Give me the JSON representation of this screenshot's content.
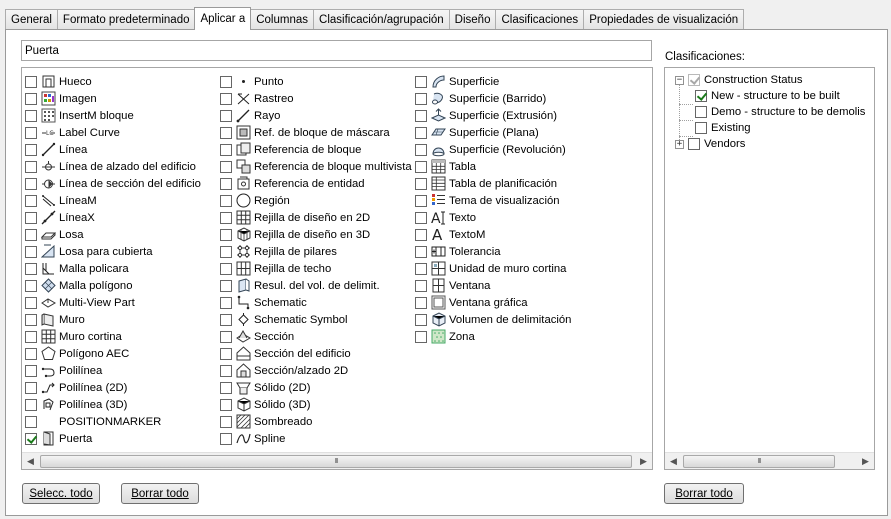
{
  "tabs": [
    {
      "label": "General",
      "active": false
    },
    {
      "label": "Formato predeterminado",
      "active": false
    },
    {
      "label": "Aplicar a",
      "active": true
    },
    {
      "label": "Columnas",
      "active": false
    },
    {
      "label": "Clasificación/agrupación",
      "active": false
    },
    {
      "label": "Diseño",
      "active": false
    },
    {
      "label": "Clasificaciones",
      "active": false
    },
    {
      "label": "Propiedades de visualización",
      "active": false
    }
  ],
  "filter_input": {
    "value": "Puerta"
  },
  "objects": {
    "col1": [
      {
        "label": "Hueco",
        "icon": "opening-icon",
        "checked": false
      },
      {
        "label": "Imagen",
        "icon": "image-icon",
        "checked": false
      },
      {
        "label": "InsertM bloque",
        "icon": "multi-insert-block-icon",
        "checked": false
      },
      {
        "label": "Label Curve",
        "icon": "label-curve-icon",
        "checked": false
      },
      {
        "label": "Línea",
        "icon": "line-icon",
        "checked": false
      },
      {
        "label": "Línea de alzado del edificio",
        "icon": "elevation-line-icon",
        "checked": false
      },
      {
        "label": "Línea de sección del edificio",
        "icon": "section-line-icon",
        "checked": false
      },
      {
        "label": "LíneaM",
        "icon": "mline-icon",
        "checked": false
      },
      {
        "label": "LíneaX",
        "icon": "xline-icon",
        "checked": false
      },
      {
        "label": "Losa",
        "icon": "slab-icon",
        "checked": false
      },
      {
        "label": "Losa para cubierta",
        "icon": "roof-slab-icon",
        "checked": false
      },
      {
        "label": "Malla policara",
        "icon": "polyface-mesh-icon",
        "checked": false
      },
      {
        "label": "Malla polígono",
        "icon": "polygon-mesh-icon",
        "checked": false
      },
      {
        "label": "Multi-View Part",
        "icon": "multi-view-part-icon",
        "checked": false
      },
      {
        "label": "Muro",
        "icon": "wall-icon",
        "checked": false
      },
      {
        "label": "Muro cortina",
        "icon": "curtain-wall-icon",
        "checked": false
      },
      {
        "label": "Polígono AEC",
        "icon": "aec-polygon-icon",
        "checked": false
      },
      {
        "label": "Polilínea",
        "icon": "polyline-icon",
        "checked": false
      },
      {
        "label": "Polilínea (2D)",
        "icon": "polyline-2d-icon",
        "checked": false
      },
      {
        "label": "Polilínea (3D)",
        "icon": "polyline-3d-icon",
        "checked": false
      },
      {
        "label": "POSITIONMARKER",
        "icon": "blank-icon",
        "checked": false
      },
      {
        "label": "Puerta",
        "icon": "door-icon",
        "checked": true
      }
    ],
    "col2": [
      {
        "label": "Punto",
        "icon": "point-icon",
        "checked": false
      },
      {
        "label": "Rastreo",
        "icon": "raytrace-icon",
        "checked": false
      },
      {
        "label": "Rayo",
        "icon": "ray-icon",
        "checked": false
      },
      {
        "label": "Ref. de bloque de máscara",
        "icon": "mask-block-ref-icon",
        "checked": false
      },
      {
        "label": "Referencia de bloque",
        "icon": "block-ref-icon",
        "checked": false
      },
      {
        "label": "Referencia de bloque multivista",
        "icon": "multiview-block-ref-icon",
        "checked": false
      },
      {
        "label": "Referencia de entidad",
        "icon": "entity-ref-icon",
        "checked": false
      },
      {
        "label": "Región",
        "icon": "region-icon",
        "checked": false
      },
      {
        "label": "Rejilla de diseño en 2D",
        "icon": "layout-grid-2d-icon",
        "checked": false
      },
      {
        "label": "Rejilla de diseño en 3D",
        "icon": "layout-grid-3d-icon",
        "checked": false
      },
      {
        "label": "Rejilla de pilares",
        "icon": "column-grid-icon",
        "checked": false
      },
      {
        "label": "Rejilla de techo",
        "icon": "ceiling-grid-icon",
        "checked": false
      },
      {
        "label": "Resul. del vol. de delimit.",
        "icon": "bounding-volume-result-icon",
        "checked": false
      },
      {
        "label": "Schematic",
        "icon": "schematic-icon",
        "checked": false
      },
      {
        "label": "Schematic Symbol",
        "icon": "schematic-symbol-icon",
        "checked": false
      },
      {
        "label": "Sección",
        "icon": "section-icon",
        "checked": false
      },
      {
        "label": "Sección del edificio",
        "icon": "building-section-icon",
        "checked": false
      },
      {
        "label": "Sección/alzado 2D",
        "icon": "section-elevation-2d-icon",
        "checked": false
      },
      {
        "label": "Sólido (2D)",
        "icon": "solid-2d-icon",
        "checked": false
      },
      {
        "label": "Sólido (3D)",
        "icon": "solid-3d-icon",
        "checked": false
      },
      {
        "label": "Sombreado",
        "icon": "hatch-icon",
        "checked": false
      },
      {
        "label": "Spline",
        "icon": "spline-icon",
        "checked": false
      }
    ],
    "col3": [
      {
        "label": "Superficie",
        "icon": "surface-icon",
        "checked": false
      },
      {
        "label": "Superficie (Barrido)",
        "icon": "sweep-surface-icon",
        "checked": false
      },
      {
        "label": "Superficie (Extrusión)",
        "icon": "extrude-surface-icon",
        "checked": false
      },
      {
        "label": "Superficie (Plana)",
        "icon": "planar-surface-icon",
        "checked": false
      },
      {
        "label": "Superficie (Revolución)",
        "icon": "revolve-surface-icon",
        "checked": false
      },
      {
        "label": "Tabla",
        "icon": "table-icon",
        "checked": false
      },
      {
        "label": "Tabla de planificación",
        "icon": "schedule-table-icon",
        "checked": false
      },
      {
        "label": "Tema de visualización",
        "icon": "display-theme-icon",
        "checked": false
      },
      {
        "label": "Texto",
        "icon": "text-icon",
        "checked": false
      },
      {
        "label": "TextoM",
        "icon": "mtext-icon",
        "checked": false
      },
      {
        "label": "Tolerancia",
        "icon": "tolerance-icon",
        "checked": false
      },
      {
        "label": "Unidad de muro cortina",
        "icon": "curtain-wall-unit-icon",
        "checked": false
      },
      {
        "label": "Ventana",
        "icon": "window-icon",
        "checked": false
      },
      {
        "label": "Ventana gráfica",
        "icon": "viewport-icon",
        "checked": false
      },
      {
        "label": "Volumen de delimitación",
        "icon": "bounding-volume-icon",
        "checked": false
      },
      {
        "label": "Zona",
        "icon": "zone-icon",
        "checked": false
      }
    ]
  },
  "classifications": {
    "label": "Clasificaciones:",
    "tree": [
      {
        "label": "Construction Status",
        "expander": "−",
        "checked": true,
        "gray": true,
        "children": [
          {
            "label": "New - structure to be built",
            "checked": true
          },
          {
            "label": "Demo - structure to be demolis",
            "checked": false
          },
          {
            "label": "Existing",
            "checked": false
          }
        ]
      },
      {
        "label": "Vendors",
        "expander": "+",
        "checked": false,
        "gray": false,
        "children": []
      }
    ]
  },
  "buttons": {
    "select_all": "Selecc. todo",
    "clear_all": "Borrar todo",
    "clear_all_classifications": "Borrar todo"
  },
  "scrollbar": {
    "grip": "III"
  }
}
